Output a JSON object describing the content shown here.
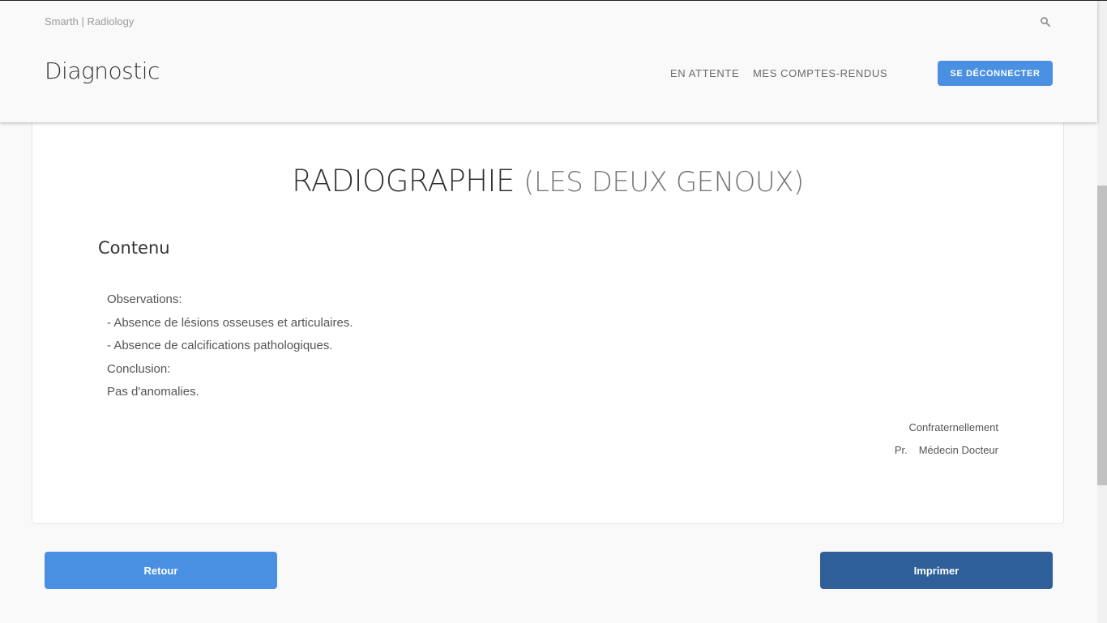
{
  "header": {
    "brand": "Smarth | Radiology",
    "page_title": "Diagnostic",
    "nav": {
      "pending": "EN ATTENTE",
      "my_reports": "MES COMPTES-RENDUS"
    },
    "logout_label": "SE DÉCONNECTER",
    "icons": {
      "search": "search-icon"
    }
  },
  "report": {
    "exam_type": "RADIOGRAPHIE",
    "exam_region": "(LES DEUX GENOUX)",
    "section_heading": "Contenu",
    "lines": [
      "Observations:",
      "- Absence de lésions osseuses et articulaires.",
      "- Absence de calcifications pathologiques.",
      "Conclusion:",
      "Pas d'anomalies."
    ],
    "signature": {
      "closing": "Confraternellement",
      "title": "Pr.",
      "name": "Médecin Docteur"
    }
  },
  "actions": {
    "back_label": "Retour",
    "print_label": "Imprimer"
  },
  "colors": {
    "primary": "#4a90e2",
    "primary_dark": "#2f5f99",
    "background": "#f9f9f9"
  }
}
